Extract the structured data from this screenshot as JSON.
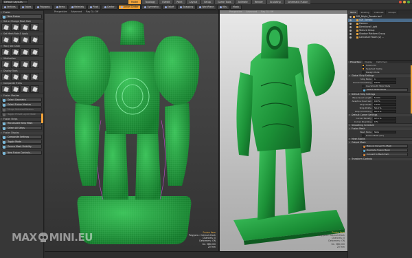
{
  "menubar": {
    "layout": "Default Layouts",
    "tabs": [
      "Model",
      "Topology",
      "UVedit",
      "Paint",
      "Layout",
      "Setup",
      "Game Tools",
      "Animate",
      "Render",
      "Sculpting",
      "Schematic Fusion"
    ],
    "active_tab": "Model"
  },
  "toolbar": {
    "tools": [
      "Vertices",
      "Edges",
      "Polygons",
      "Items",
      "Materials",
      "Pivot",
      "Center",
      "Action Center",
      "Symmetry",
      "Falloff",
      "Snapping",
      "WorkPlane",
      "Kits"
    ],
    "active_tool": "Action Center",
    "extra": "Modo"
  },
  "left_panel": {
    "sections": [
      {
        "title": "Fusion",
        "buttons": [
          "New Fusion"
        ]
      },
      {
        "title": "Set or Change Mesh Role",
        "icons": 4
      },
      {
        "title": "Set Mesh Role & Apply",
        "icons": 4
      },
      {
        "title": "Two / Sec Chan",
        "icons": 4
      },
      {
        "title": "Vitalization",
        "icons": 4
      },
      {
        "title": "Display Tools",
        "icons": 4
      },
      {
        "title": "Composite Tricks",
        "icons": 4
      }
    ],
    "fusion_meshes": {
      "title": "Fusion Meshes",
      "buttons": [
        "Select Geometry",
        "Select Fusion Meshes",
        "Merge Selected Meshes",
        "Toggle Preset Layer Mode"
      ]
    },
    "fusion_strips": {
      "title": "Fusion Strips",
      "buttons": [
        "Recalculate Strip Mesh",
        "Select All Strips"
      ]
    },
    "fusion_display": {
      "title": "Fusion Display",
      "buttons": [
        "Composite Settings",
        "Toggle Mode",
        "Source Mesh Visibility"
      ]
    },
    "bottom_button": "New Fusion Controls..."
  },
  "viewport_left": {
    "header": [
      "Perspective",
      "Advanced",
      "Ray GL: Off"
    ],
    "info": {
      "label": "Fusion Item",
      "lines": [
        "Polygons : Catmull-Clark",
        "Channels: 0",
        "Deformers: ON",
        "GL: 386,000",
        "20 mm"
      ]
    }
  },
  "viewport_right": {
    "header": [
      "Perspective",
      "Advanced",
      "Ray GL: Off"
    ],
    "info": {
      "label": "Fusion Item",
      "lines": [
        "Polygons : Catmull-Clark",
        "Channels: 0",
        "Deformers: ON",
        "GL: 386,000",
        "20 mm"
      ]
    }
  },
  "item_list": {
    "tabs": [
      "Items",
      "Shading",
      "Channels",
      "Groups"
    ],
    "active_tab": "Items",
    "rows": [
      {
        "label": "SSR_Bright_Tomato.lxo*",
        "indent": 0,
        "selected": false
      },
      {
        "label": "SSR_Tomato",
        "indent": 1,
        "selected": true
      },
      {
        "label": "Camera",
        "indent": 1,
        "selected": false
      },
      {
        "label": "Directional Light",
        "indent": 1,
        "selected": false
      },
      {
        "label": "Texture Group",
        "indent": 1,
        "selected": false
      },
      {
        "label": "Shadow Platform Group",
        "indent": 1,
        "selected": false
      },
      {
        "label": "Caricature Room (2) ...",
        "indent": 1,
        "selected": false
      }
    ]
  },
  "properties": {
    "tabs": [
      "Properties",
      "Display",
      "Deformers"
    ],
    "active_tab": "Properties",
    "checks": [
      {
        "label": "Fusion On",
        "on": true
      },
      {
        "label": "Selected Visible",
        "on": true
      },
      {
        "label": "Design Mode",
        "on": false
      }
    ],
    "global_strip": {
      "title": "Global Strip Settings",
      "rows": [
        {
          "label": "Strip Mode",
          "value": "1"
        },
        {
          "label": "Corner Smoothing",
          "value": "0.0 %"
        }
      ],
      "check": "Use Smooth Strip Mode",
      "button": "Select Width Mode"
    },
    "default_strip": {
      "title": "Default Strip Settings",
      "rows": [
        {
          "label": "Base Quad Length",
          "value": "5 mm"
        },
        {
          "label": "Adaptive Quad Len",
          "value": "0.0 %"
        },
        {
          "label": "Strip Width",
          "value": "1.0 %"
        },
        {
          "label": "Strip Profile",
          "value": "50.0 %"
        },
        {
          "label": "Strip Smoothing",
          "value": "50.0 %"
        }
      ]
    },
    "default_corner": {
      "title": "Default Corner Settings",
      "rows": [
        {
          "label": "Corner Density",
          "value": "12.5 %"
        },
        {
          "label": "Corner Rounding",
          "value": "0 %"
        }
      ]
    },
    "smoothing": {
      "title": "Smoothing Schedule"
    },
    "fusion_mesh": {
      "title": "Fusion Mesh",
      "rows": [
        {
          "label": "Mesh Mode",
          "value": "Strip"
        }
      ],
      "check": "Fusion Mesh (On)"
    },
    "mesh_blocks": {
      "title": "Mesh Blocks"
    },
    "output_mesh": {
      "title": "Output Mesh",
      "buttons": [
        "Bake & Convert to Mesh",
        "Duplicate Fusion Mesh",
        "Convert to Mesh Item"
      ]
    },
    "transform": {
      "title": "Transform Controls"
    }
  },
  "colors": {
    "accent": "#f2a33a",
    "model_green": "#1e9a3a",
    "selection": "#4a6b8a"
  },
  "watermark": {
    "left": "MAX",
    "right": "MINI.EU"
  }
}
